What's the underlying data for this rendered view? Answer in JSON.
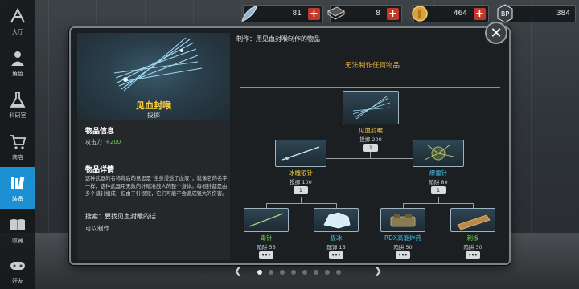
{
  "nav": {
    "items": [
      {
        "label": "大厅",
        "icon": "hall-icon"
      },
      {
        "label": "角色",
        "icon": "character-icon"
      },
      {
        "label": "科研室",
        "icon": "lab-flask-icon"
      },
      {
        "label": "商店",
        "icon": "shop-cart-icon"
      },
      {
        "label": "装备",
        "icon": "books-icon"
      },
      {
        "label": "收藏",
        "icon": "collection-book-icon"
      },
      {
        "label": "好友",
        "icon": "friends-gamepad-icon"
      }
    ],
    "active_index": 4
  },
  "resources": [
    {
      "name": "feather",
      "value": "81",
      "icon": "feather-icon"
    },
    {
      "name": "book",
      "value": "8",
      "icon": "book-icon"
    },
    {
      "name": "coin",
      "value": "464",
      "icon": "coin-icon"
    },
    {
      "name": "points",
      "value": "384",
      "icon": "bp-token-icon"
    }
  ],
  "item": {
    "name": "见血封喉",
    "type": "投掷",
    "info_title": "物品信息",
    "attack_label": "攻击力",
    "attack_value": "+200",
    "details_title": "物品详情",
    "description": "这种武器的名称背后的意思是“全身浸透了血液”，就像它的名字一样，这种武器用无数的针暗准敌人的整个身体。每根针都是由多个缝针组成，但由于针很短，它们可能不会造成强大的伤害。",
    "search_text": "搜索：要找见血封喉的话……",
    "can_craft": "可以制作"
  },
  "craft": {
    "header": "制作：用见血封喉制作的物品",
    "cannot_craft": "无法制作任何物品"
  },
  "tree": {
    "root": {
      "name": "见血封喉",
      "sub": "投掷 200",
      "count": "1"
    },
    "mid": [
      {
        "name": "冰魄银针",
        "sub": "投掷 100",
        "count": "1",
        "color": "#f2d23b"
      },
      {
        "name": "爆雷针",
        "sub": "陷阱 80",
        "count": "1",
        "color": "#3fc6f0"
      }
    ],
    "leaf": [
      {
        "name": "毒针",
        "sub": "陷阱 56",
        "count": "•••",
        "color": "#6fd24a"
      },
      {
        "name": "极冰",
        "sub": "配饰 16",
        "count": "•••",
        "color": "#3fc6f0"
      },
      {
        "name": "RDX高能炸药",
        "sub": "陷阱 50",
        "count": "•••",
        "color": "#3fc6f0"
      },
      {
        "name": "刺板",
        "sub": "陷阱 30",
        "count": "•••",
        "color": "#6fd24a"
      }
    ]
  },
  "pager": {
    "count": 8,
    "active": 0
  }
}
